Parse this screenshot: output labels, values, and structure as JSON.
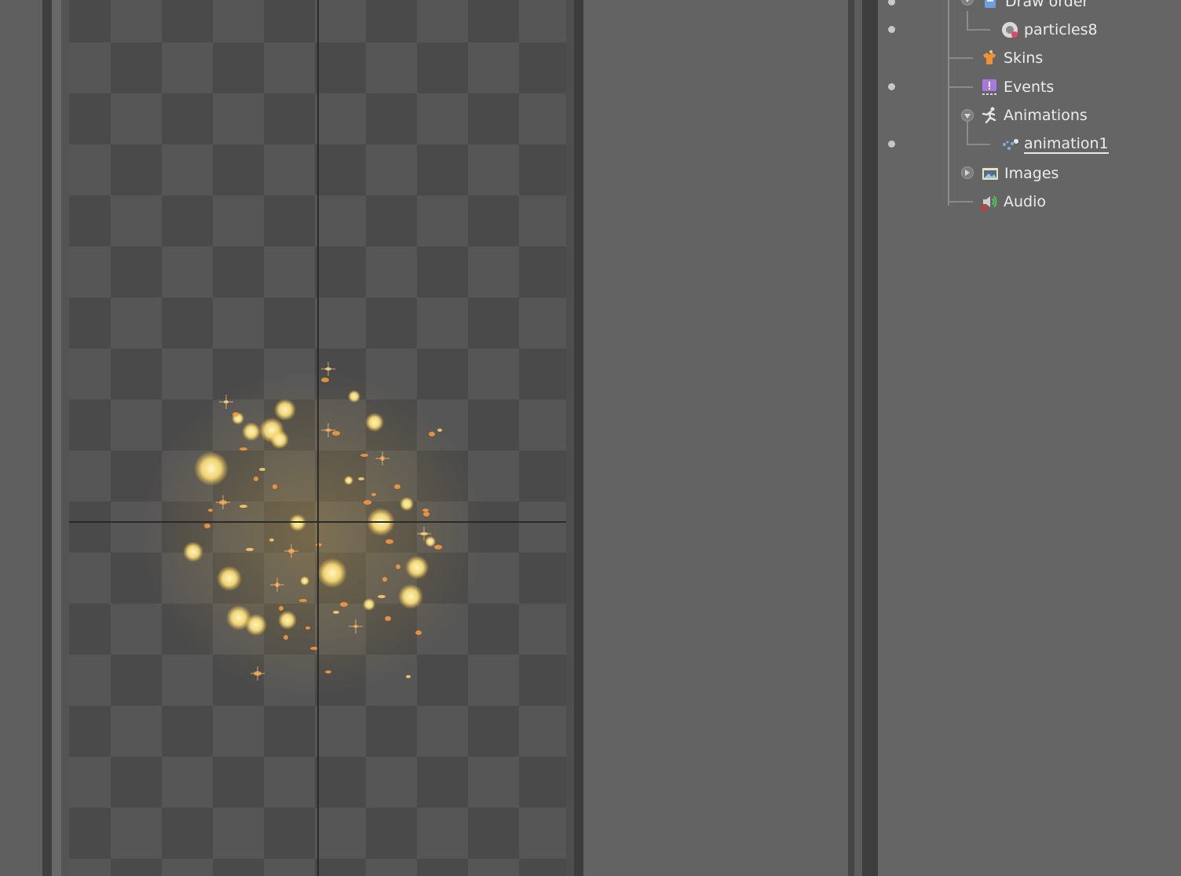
{
  "tree": {
    "items": [
      {
        "label": "Draw order",
        "icon": "draw-order-icon"
      },
      {
        "label": "particles8",
        "icon": "slot-icon"
      },
      {
        "label": "Skins",
        "icon": "skins-icon"
      },
      {
        "label": "Events",
        "icon": "events-icon"
      },
      {
        "label": "Animations",
        "icon": "animations-icon"
      },
      {
        "label": "animation1",
        "icon": "animation-icon"
      },
      {
        "label": "Images",
        "icon": "images-icon"
      },
      {
        "label": "Audio",
        "icon": "audio-icon"
      }
    ]
  },
  "colors": {
    "particle_core": "#ffe58a",
    "particle_spark": "#ff9a3c",
    "checker_dark": "#4a4a4a",
    "checker_light": "#565656"
  }
}
